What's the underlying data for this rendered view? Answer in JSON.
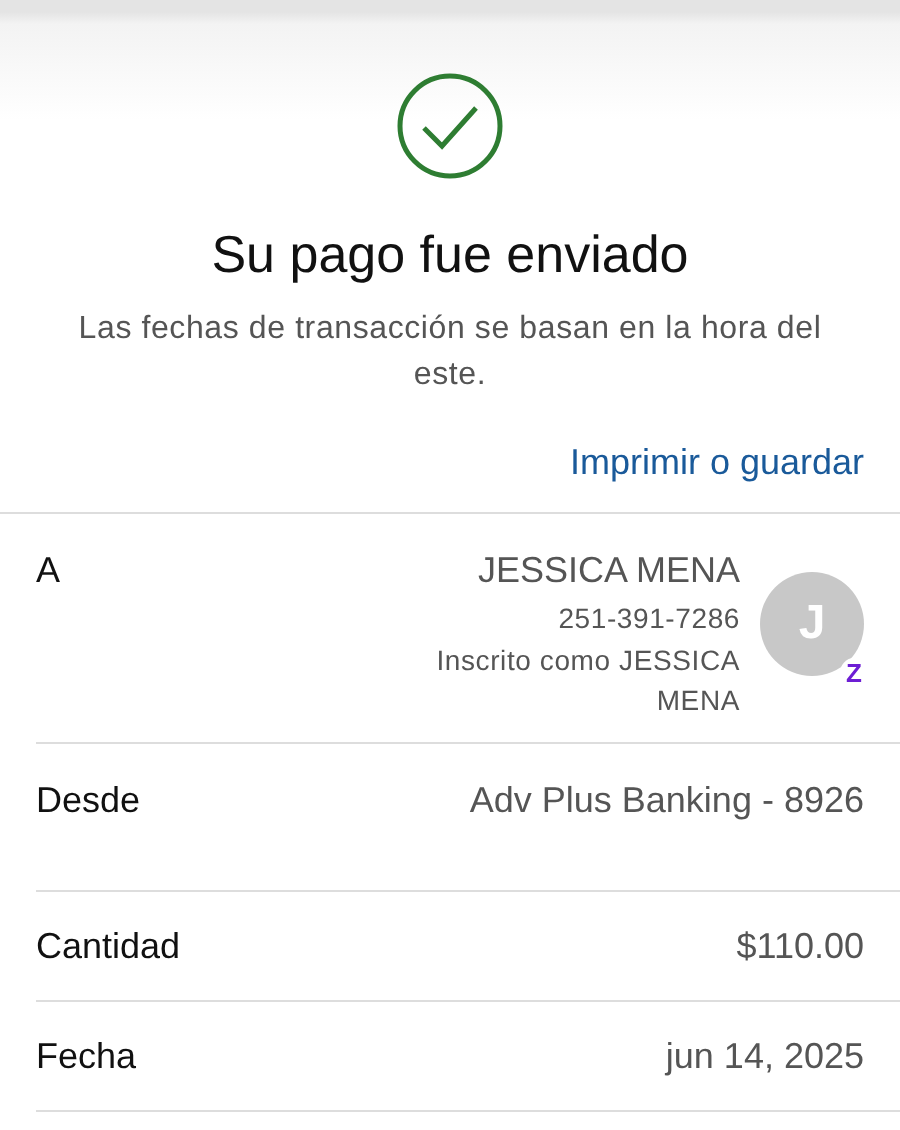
{
  "status": {
    "title": "Su pago fue enviado",
    "subtitle": "Las fechas de transacción se basan en la hora del este.",
    "link": "Imprimir o guardar"
  },
  "rows": [
    {
      "kind": "recipient",
      "label": "A",
      "name": "JESSICA MENA",
      "phone": "251-391-7286",
      "note": "Inscrito como JESSICA MENA",
      "avatar": "J",
      "badge": "Z"
    },
    {
      "kind": "simple",
      "label": "Desde",
      "value": "Adv Plus Banking - 8926",
      "tall": true
    },
    {
      "kind": "simple",
      "label": "Cantidad",
      "value": "$110.00",
      "tall": false
    },
    {
      "kind": "simple",
      "label": "Fecha",
      "value": "jun 14, 2025",
      "tall": false
    }
  ]
}
